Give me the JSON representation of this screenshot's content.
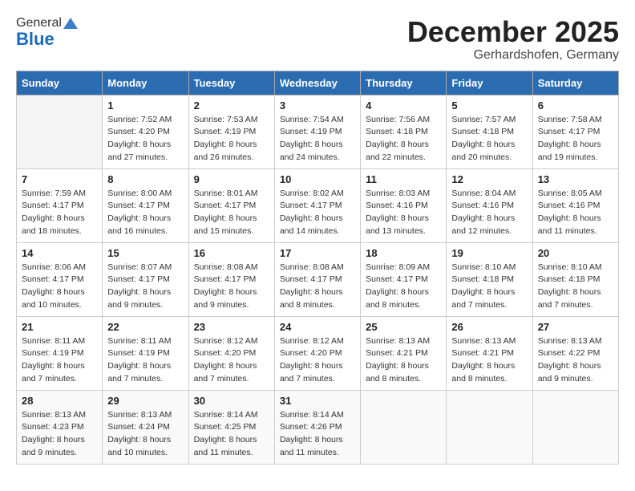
{
  "header": {
    "logo_general": "General",
    "logo_blue": "Blue",
    "month_title": "December 2025",
    "location": "Gerhardshofen, Germany"
  },
  "columns": [
    "Sunday",
    "Monday",
    "Tuesday",
    "Wednesday",
    "Thursday",
    "Friday",
    "Saturday"
  ],
  "weeks": [
    [
      {
        "day": "",
        "info": ""
      },
      {
        "day": "1",
        "info": "Sunrise: 7:52 AM\nSunset: 4:20 PM\nDaylight: 8 hours\nand 27 minutes."
      },
      {
        "day": "2",
        "info": "Sunrise: 7:53 AM\nSunset: 4:19 PM\nDaylight: 8 hours\nand 26 minutes."
      },
      {
        "day": "3",
        "info": "Sunrise: 7:54 AM\nSunset: 4:19 PM\nDaylight: 8 hours\nand 24 minutes."
      },
      {
        "day": "4",
        "info": "Sunrise: 7:56 AM\nSunset: 4:18 PM\nDaylight: 8 hours\nand 22 minutes."
      },
      {
        "day": "5",
        "info": "Sunrise: 7:57 AM\nSunset: 4:18 PM\nDaylight: 8 hours\nand 20 minutes."
      },
      {
        "day": "6",
        "info": "Sunrise: 7:58 AM\nSunset: 4:17 PM\nDaylight: 8 hours\nand 19 minutes."
      }
    ],
    [
      {
        "day": "7",
        "info": "Sunrise: 7:59 AM\nSunset: 4:17 PM\nDaylight: 8 hours\nand 18 minutes."
      },
      {
        "day": "8",
        "info": "Sunrise: 8:00 AM\nSunset: 4:17 PM\nDaylight: 8 hours\nand 16 minutes."
      },
      {
        "day": "9",
        "info": "Sunrise: 8:01 AM\nSunset: 4:17 PM\nDaylight: 8 hours\nand 15 minutes."
      },
      {
        "day": "10",
        "info": "Sunrise: 8:02 AM\nSunset: 4:17 PM\nDaylight: 8 hours\nand 14 minutes."
      },
      {
        "day": "11",
        "info": "Sunrise: 8:03 AM\nSunset: 4:16 PM\nDaylight: 8 hours\nand 13 minutes."
      },
      {
        "day": "12",
        "info": "Sunrise: 8:04 AM\nSunset: 4:16 PM\nDaylight: 8 hours\nand 12 minutes."
      },
      {
        "day": "13",
        "info": "Sunrise: 8:05 AM\nSunset: 4:16 PM\nDaylight: 8 hours\nand 11 minutes."
      }
    ],
    [
      {
        "day": "14",
        "info": "Sunrise: 8:06 AM\nSunset: 4:17 PM\nDaylight: 8 hours\nand 10 minutes."
      },
      {
        "day": "15",
        "info": "Sunrise: 8:07 AM\nSunset: 4:17 PM\nDaylight: 8 hours\nand 9 minutes."
      },
      {
        "day": "16",
        "info": "Sunrise: 8:08 AM\nSunset: 4:17 PM\nDaylight: 8 hours\nand 9 minutes."
      },
      {
        "day": "17",
        "info": "Sunrise: 8:08 AM\nSunset: 4:17 PM\nDaylight: 8 hours\nand 8 minutes."
      },
      {
        "day": "18",
        "info": "Sunrise: 8:09 AM\nSunset: 4:17 PM\nDaylight: 8 hours\nand 8 minutes."
      },
      {
        "day": "19",
        "info": "Sunrise: 8:10 AM\nSunset: 4:18 PM\nDaylight: 8 hours\nand 7 minutes."
      },
      {
        "day": "20",
        "info": "Sunrise: 8:10 AM\nSunset: 4:18 PM\nDaylight: 8 hours\nand 7 minutes."
      }
    ],
    [
      {
        "day": "21",
        "info": "Sunrise: 8:11 AM\nSunset: 4:19 PM\nDaylight: 8 hours\nand 7 minutes."
      },
      {
        "day": "22",
        "info": "Sunrise: 8:11 AM\nSunset: 4:19 PM\nDaylight: 8 hours\nand 7 minutes."
      },
      {
        "day": "23",
        "info": "Sunrise: 8:12 AM\nSunset: 4:20 PM\nDaylight: 8 hours\nand 7 minutes."
      },
      {
        "day": "24",
        "info": "Sunrise: 8:12 AM\nSunset: 4:20 PM\nDaylight: 8 hours\nand 7 minutes."
      },
      {
        "day": "25",
        "info": "Sunrise: 8:13 AM\nSunset: 4:21 PM\nDaylight: 8 hours\nand 8 minutes."
      },
      {
        "day": "26",
        "info": "Sunrise: 8:13 AM\nSunset: 4:21 PM\nDaylight: 8 hours\nand 8 minutes."
      },
      {
        "day": "27",
        "info": "Sunrise: 8:13 AM\nSunset: 4:22 PM\nDaylight: 8 hours\nand 9 minutes."
      }
    ],
    [
      {
        "day": "28",
        "info": "Sunrise: 8:13 AM\nSunset: 4:23 PM\nDaylight: 8 hours\nand 9 minutes."
      },
      {
        "day": "29",
        "info": "Sunrise: 8:13 AM\nSunset: 4:24 PM\nDaylight: 8 hours\nand 10 minutes."
      },
      {
        "day": "30",
        "info": "Sunrise: 8:14 AM\nSunset: 4:25 PM\nDaylight: 8 hours\nand 11 minutes."
      },
      {
        "day": "31",
        "info": "Sunrise: 8:14 AM\nSunset: 4:26 PM\nDaylight: 8 hours\nand 11 minutes."
      },
      {
        "day": "",
        "info": ""
      },
      {
        "day": "",
        "info": ""
      },
      {
        "day": "",
        "info": ""
      }
    ]
  ]
}
